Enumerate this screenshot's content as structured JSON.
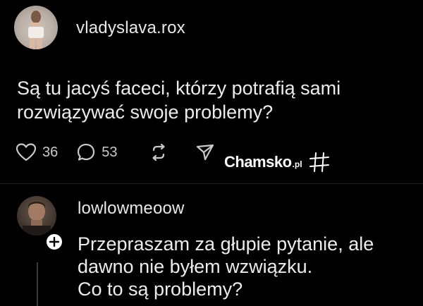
{
  "post": {
    "username": "vladyslava.rox",
    "text": "Są tu jacyś faceci, którzy potrafią sami rozwiązywać swoje problemy?",
    "likes": "36",
    "comments": "53"
  },
  "reply": {
    "username": "lowlowmeoow",
    "text_line1": "Przepraszam za głupie pytanie, ale",
    "text_line2": "dawno nie byłem wzwiązku.",
    "text_line3": "Co to są problemy?"
  },
  "watermark": {
    "brand": "Chamsko",
    "tld": ".pl"
  }
}
